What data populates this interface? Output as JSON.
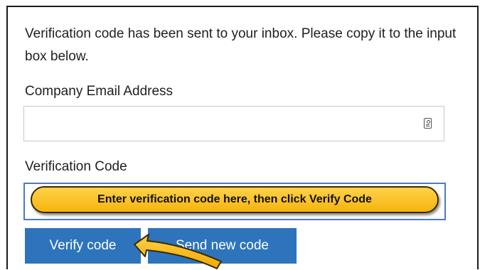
{
  "intro_text": "Verification code has been sent to your inbox. Please copy it to the input box below.",
  "email": {
    "label": "Company Email Address",
    "value": "",
    "icon": "contact-card-icon"
  },
  "code": {
    "label": "Verification Code",
    "value": "",
    "callout_text": "Enter verification code here, then click Verify Code"
  },
  "buttons": {
    "verify_label": "Verify code",
    "send_new_label": "Send new code"
  },
  "colors": {
    "button_blue": "#2d74bd",
    "callout_yellow": "#f6b40e",
    "input_focus_border": "#4a7bc8"
  }
}
